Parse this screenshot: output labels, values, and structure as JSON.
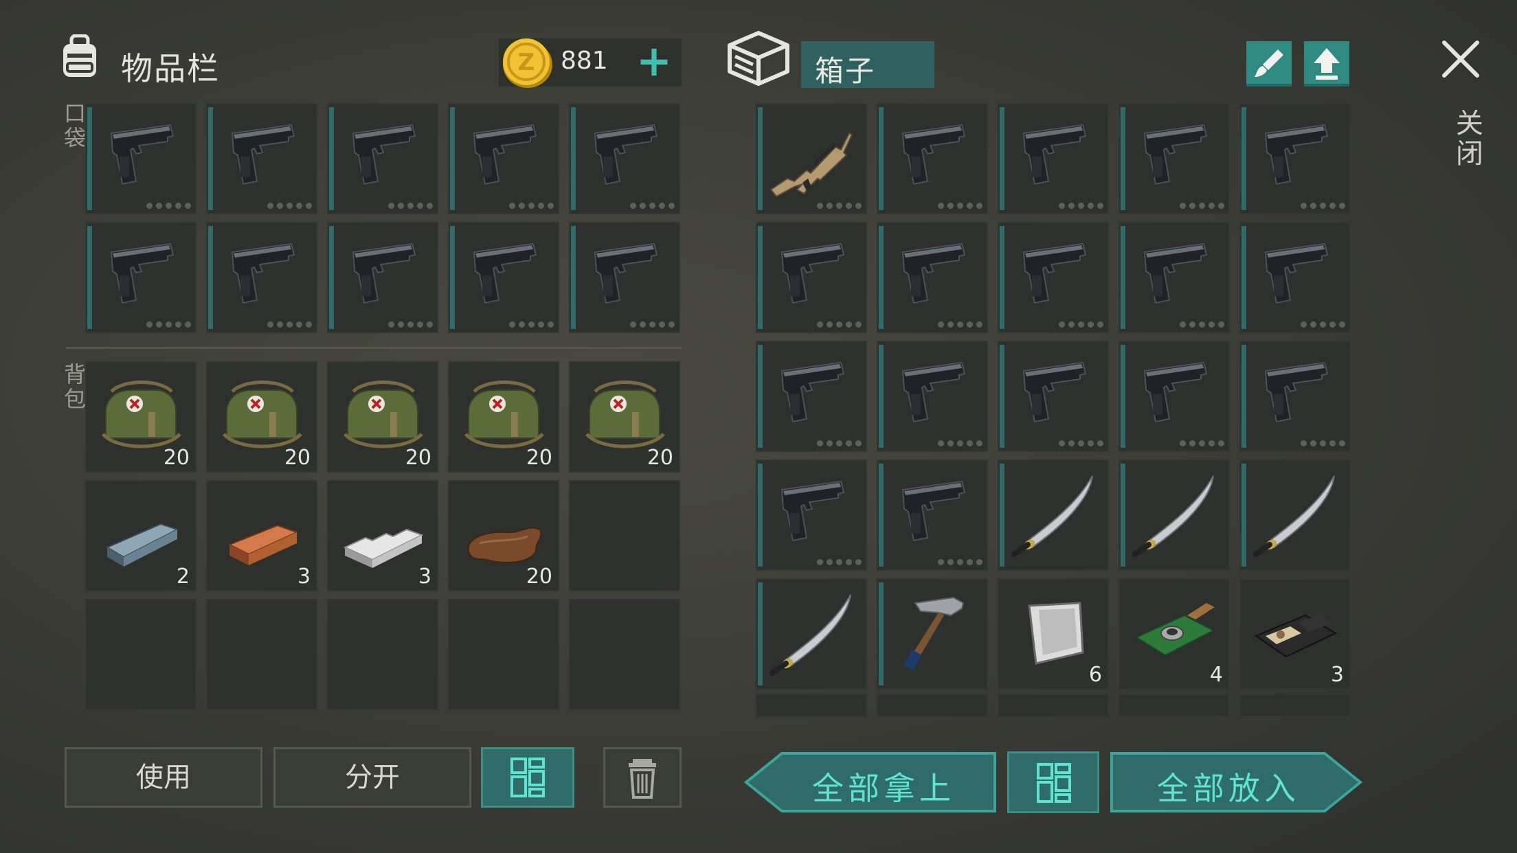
{
  "inventory": {
    "title": "物品栏",
    "coins": "881",
    "add_symbol": "+",
    "pocket_label": "口袋",
    "backpack_label": "背包",
    "pocket_slots": [
      {
        "item": "pistol-icon"
      },
      {
        "item": "pistol-icon"
      },
      {
        "item": "pistol-icon"
      },
      {
        "item": "pistol-icon"
      },
      {
        "item": "pistol-icon"
      },
      {
        "item": "pistol-icon"
      },
      {
        "item": "pistol-icon"
      },
      {
        "item": "pistol-icon"
      },
      {
        "item": "pistol-icon"
      },
      {
        "item": "pistol-icon"
      }
    ],
    "backpack_slots": [
      {
        "item": "medkit-bag-icon",
        "count": "20"
      },
      {
        "item": "medkit-bag-icon",
        "count": "20"
      },
      {
        "item": "medkit-bag-icon",
        "count": "20"
      },
      {
        "item": "medkit-bag-icon",
        "count": "20"
      },
      {
        "item": "medkit-bag-icon",
        "count": "20"
      },
      {
        "item": "steel-ingot-icon",
        "count": "2"
      },
      {
        "item": "copper-ingot-icon",
        "count": "3"
      },
      {
        "item": "aluminum-bar-icon",
        "count": "3"
      },
      {
        "item": "leather-icon",
        "count": "20"
      },
      {
        "item": "empty"
      },
      {
        "item": "empty"
      },
      {
        "item": "empty"
      },
      {
        "item": "empty"
      },
      {
        "item": "empty"
      },
      {
        "item": "empty"
      }
    ]
  },
  "box": {
    "title": "箱子",
    "slots": [
      {
        "item": "rifle-icon"
      },
      {
        "item": "pistol-icon"
      },
      {
        "item": "pistol-icon"
      },
      {
        "item": "pistol-icon"
      },
      {
        "item": "pistol-icon"
      },
      {
        "item": "pistol-icon"
      },
      {
        "item": "pistol-icon"
      },
      {
        "item": "pistol-icon"
      },
      {
        "item": "pistol-icon"
      },
      {
        "item": "pistol-icon"
      },
      {
        "item": "pistol-icon"
      },
      {
        "item": "pistol-icon"
      },
      {
        "item": "pistol-icon"
      },
      {
        "item": "pistol-icon"
      },
      {
        "item": "pistol-icon"
      },
      {
        "item": "pistol-icon"
      },
      {
        "item": "pistol-icon"
      },
      {
        "item": "katana-icon"
      },
      {
        "item": "katana-icon"
      },
      {
        "item": "katana-icon"
      },
      {
        "item": "katana-icon"
      },
      {
        "item": "hammer-icon"
      },
      {
        "item": "metal-sheet-icon",
        "count": "6"
      },
      {
        "item": "circuit-board-icon",
        "count": "4"
      },
      {
        "item": "id-wallet-icon",
        "count": "3"
      }
    ]
  },
  "buttons": {
    "use": "使用",
    "split": "分开",
    "take_all": "全部拿上",
    "put_all": "全部放入",
    "close": "关闭"
  },
  "colors": {
    "accent": "#3fbfae",
    "teal_button": "#2f8a82",
    "slot_bg": "#2d302c"
  }
}
